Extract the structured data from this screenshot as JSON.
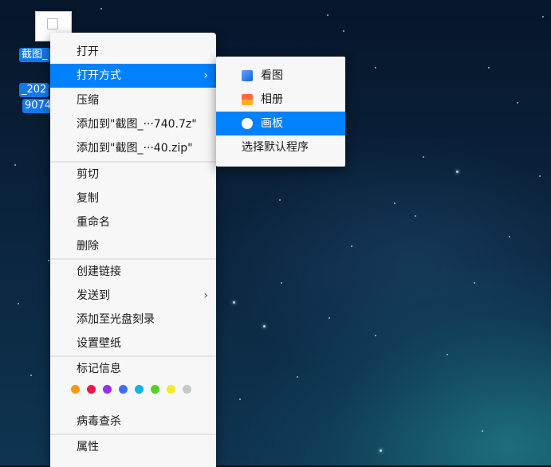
{
  "desktop_icon": {
    "label_lines": [
      "截图_",
      "_202",
      "9074"
    ]
  },
  "context_menu": {
    "open": "打开",
    "open_with": "打开方式",
    "compress": "压缩",
    "add_to_7z": "添加到\"截图_···740.7z\"",
    "add_to_zip": "添加到\"截图_···40.zip\"",
    "cut": "剪切",
    "copy": "复制",
    "rename": "重命名",
    "delete": "删除",
    "create_link": "创建链接",
    "send_to": "发送到",
    "add_to_disc": "添加至光盘刻录",
    "set_wallpaper": "设置壁纸",
    "tag_info": "标记信息",
    "tag_colors": [
      "#f59a10",
      "#f0164b",
      "#9b2ee6",
      "#3b6ef5",
      "#10b3e8",
      "#51d321",
      "#f5e92c",
      "#c8c8c8"
    ],
    "virus_scan": "病毒查杀",
    "properties": "属性",
    "submenu_arrow": "›"
  },
  "open_with_submenu": {
    "items": [
      {
        "label": "看图",
        "icon": "image-viewer-icon"
      },
      {
        "label": "相册",
        "icon": "album-icon"
      },
      {
        "label": "画板",
        "icon": "draw-board-icon"
      }
    ],
    "choose_default": "选择默认程序",
    "highlighted": "画板"
  }
}
